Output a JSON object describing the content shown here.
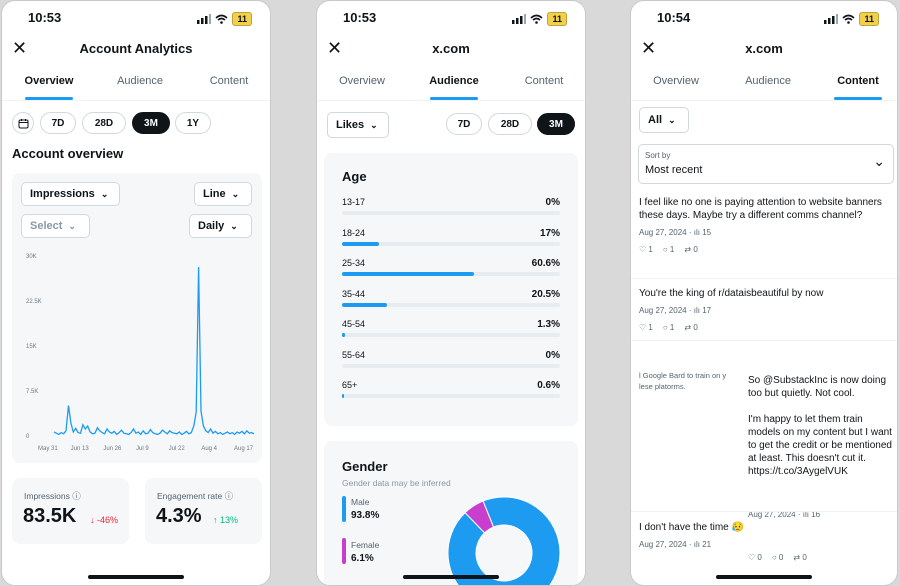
{
  "status": {
    "p1_time": "10:53",
    "p2_time": "10:53",
    "p3_time": "10:54",
    "battery": "11"
  },
  "p1": {
    "title": "Account Analytics",
    "tabs": [
      "Overview",
      "Audience",
      "Content"
    ],
    "ranges": [
      "7D",
      "28D",
      "3M",
      "1Y"
    ],
    "selected_range": "3M",
    "section_title": "Account overview",
    "metric_dd": "Impressions",
    "chart_type_dd": "Line",
    "select_dd": "Select",
    "interval_dd": "Daily",
    "cards": [
      {
        "label": "Impressions",
        "value": "83.5K",
        "delta": "↓ -46%",
        "delta_color": "#f4212e"
      },
      {
        "label": "Engagement rate",
        "value": "4.3%",
        "delta": "↑ 13%",
        "delta_color": "#00ba7c"
      }
    ]
  },
  "chart_data": {
    "type": "line",
    "ylabel": "",
    "xlabel": "",
    "yticks": [
      "30K",
      "22.5K",
      "15K",
      "7.5K",
      "0"
    ],
    "ylim": [
      0,
      30000
    ],
    "xticks": [
      "May 31",
      "Jun 13",
      "Jun 26",
      "Jul 9",
      "Jul 22",
      "Aug 4",
      "Aug 17"
    ],
    "series": [
      {
        "values": [
          1000,
          800,
          600,
          900,
          700,
          1200,
          5400,
          2500,
          1000,
          1600,
          900,
          800,
          2200,
          1500,
          2000,
          1000,
          700,
          800,
          1700,
          1200,
          900,
          700,
          1500,
          1000,
          800,
          1100,
          600,
          900,
          1300,
          800,
          700,
          600,
          900,
          1500,
          800,
          1000,
          600,
          1200,
          700,
          800,
          1400,
          900,
          700,
          600,
          800,
          1300,
          1000,
          700,
          1200,
          900,
          800,
          700,
          1000,
          600,
          800,
          1100,
          700,
          900,
          2000,
          4300,
          28500,
          4500,
          2000,
          1200,
          900,
          1500,
          800,
          1100,
          700,
          900,
          600,
          800,
          1000,
          700,
          900,
          600,
          1000,
          800,
          1100,
          700,
          1200,
          800,
          900,
          700
        ]
      }
    ]
  },
  "p2": {
    "title": "x.com",
    "tabs": [
      "Overview",
      "Audience",
      "Content"
    ],
    "filter_dd": "Likes",
    "ranges": [
      "7D",
      "28D",
      "3M"
    ],
    "selected_range": "3M",
    "age_title": "Age",
    "ages": [
      {
        "label": "13-17",
        "pct": "0%",
        "frac": 0.0
      },
      {
        "label": "18-24",
        "pct": "17%",
        "frac": 0.17
      },
      {
        "label": "25-34",
        "pct": "60.6%",
        "frac": 0.606
      },
      {
        "label": "35-44",
        "pct": "20.5%",
        "frac": 0.205
      },
      {
        "label": "45-54",
        "pct": "1.3%",
        "frac": 0.013
      },
      {
        "label": "55-64",
        "pct": "0%",
        "frac": 0.0
      },
      {
        "label": "65+",
        "pct": "0.6%",
        "frac": 0.006
      }
    ],
    "gender_title": "Gender",
    "gender_note": "Gender data may be inferred",
    "genders": [
      {
        "label": "Male",
        "pct": "93.8%",
        "color": "#1d9bf0"
      },
      {
        "label": "Female",
        "pct": "6.1%",
        "color": "#c93fcd"
      }
    ]
  },
  "p3": {
    "title": "x.com",
    "tabs": [
      "Overview",
      "Audience",
      "Content"
    ],
    "filter_dd": "All",
    "sort_label": "Sort by",
    "sort_value": "Most recent",
    "posts": [
      {
        "text": "I feel like no one is paying attention to website banners these days. Maybe try a different comms channel?",
        "date": "Aug 27, 2024",
        "views": "15",
        "likes": "1",
        "replies": "1",
        "reposts": "0"
      },
      {
        "text": "You're the king of r/dataisbeautiful by now",
        "date": "Aug 27, 2024",
        "views": "17",
        "likes": "1",
        "replies": "1",
        "reposts": "0"
      },
      {
        "text": "So @SubstackInc is now doing too but quietly. Not cool.\n\nI'm happy to let them train models on my content but I want to get the credit or be mentioned at least. This doesn't cut it. https://t.co/3AygelVUK",
        "quote": "l Google Bard to train on y\nlese platorms.",
        "date": "Aug 27, 2024",
        "views": "16",
        "likes": "0",
        "replies": "0",
        "reposts": "0"
      },
      {
        "text": "I don't have the time 😥",
        "date": "Aug 27, 2024",
        "views": "21",
        "likes": "",
        "replies": "",
        "reposts": ""
      }
    ]
  }
}
